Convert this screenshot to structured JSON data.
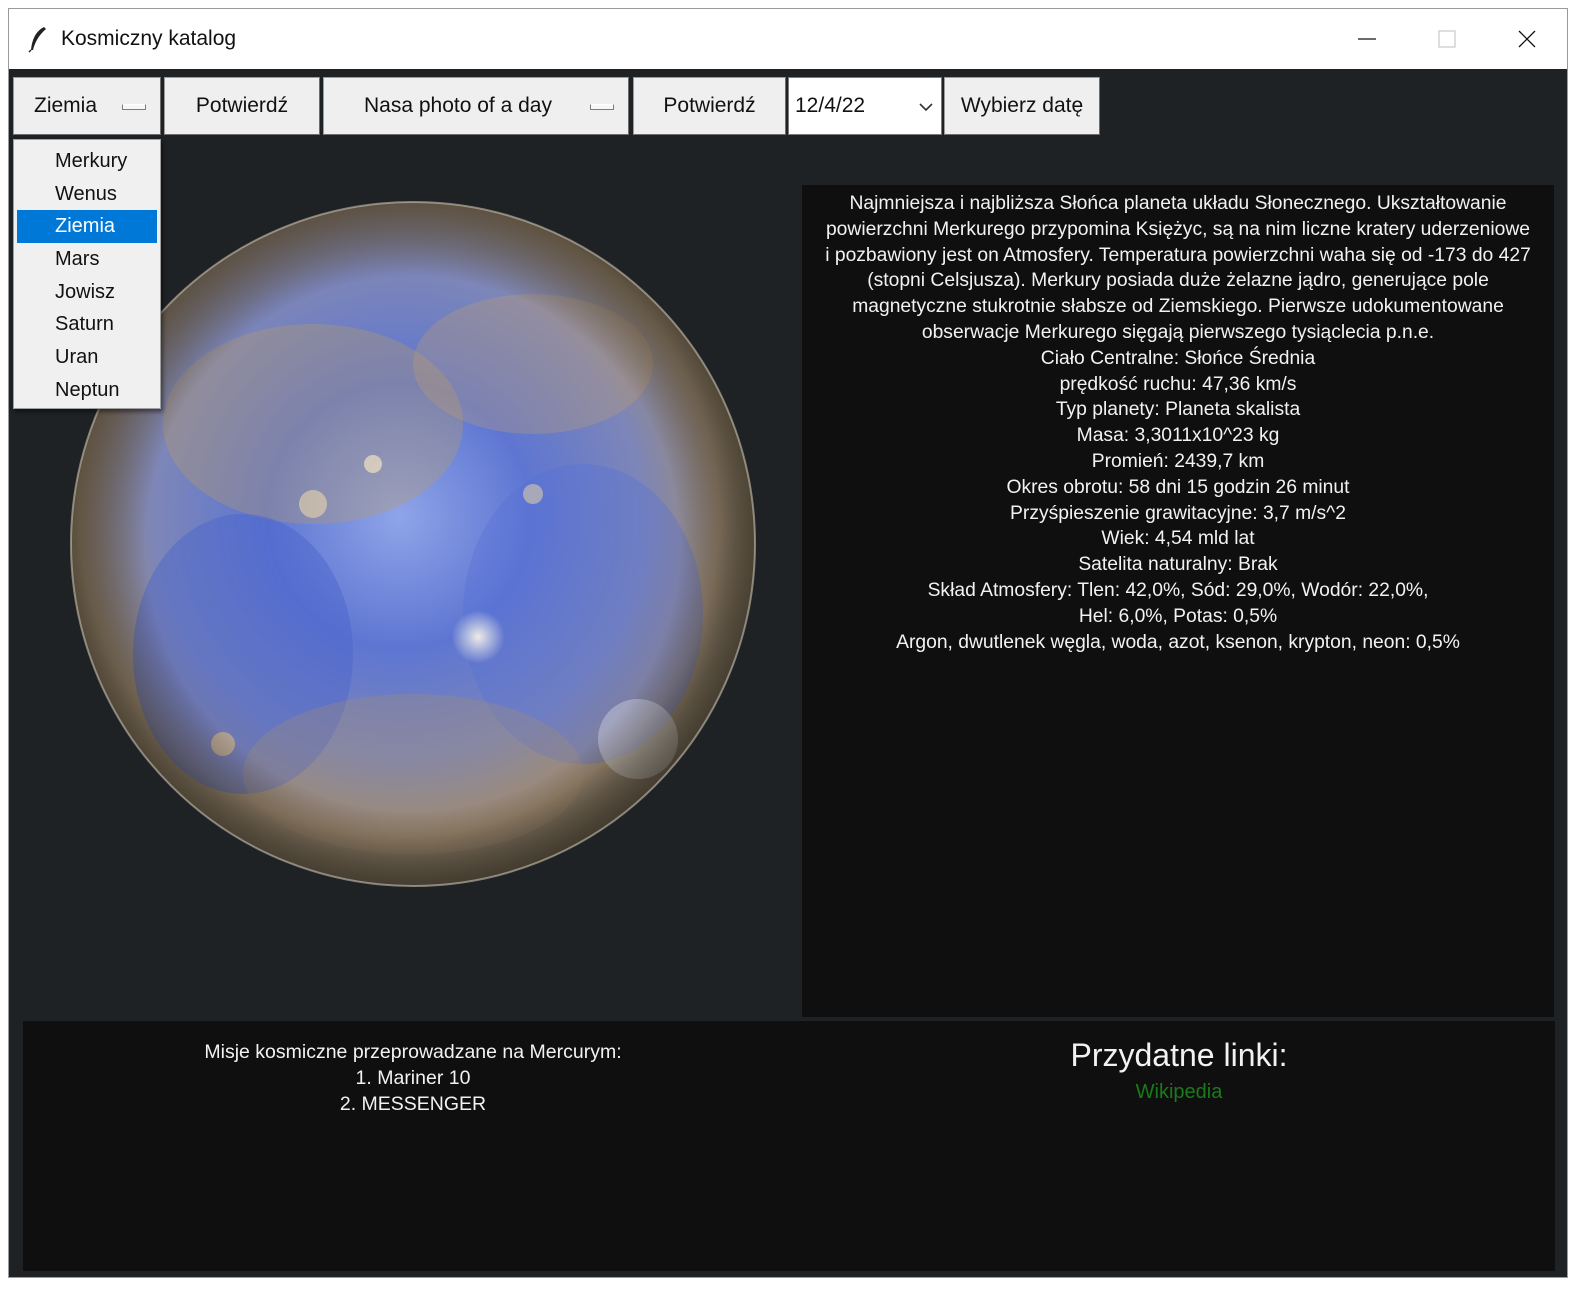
{
  "window": {
    "title": "Kosmiczny katalog"
  },
  "toolbar": {
    "planet_selected": "Ziemia",
    "confirm_label_1": "Potwierdź",
    "mode_selected": "Nasa photo of a day",
    "confirm_label_2": "Potwierdź",
    "date_value": "12/4/22",
    "pick_date_label": "Wybierz datę"
  },
  "dropdown": {
    "items": [
      "Merkury",
      "Wenus",
      "Ziemia",
      "Mars",
      "Jowisz",
      "Saturn",
      "Uran",
      "Neptun"
    ],
    "selected": "Ziemia"
  },
  "info": {
    "lines": [
      "Najmniejsza i najbliższa Słońca planeta układu Słonecznego. Ukształtowanie",
      "powierzchni Merkurego przypomina Księżyc, są na nim liczne kratery uderzeniowe",
      "i pozbawiony jest on Atmosfery. Temperatura powierzchni waha się od -173 do 427",
      "(stopni Celsjusza). Merkury posiada duże żelazne jądro, generujące pole",
      "magnetyczne stukrotnie słabsze od Ziemskiego. Pierwsze udokumentowane",
      "obserwacje Merkurego sięgają pierwszego tysiąclecia p.n.e.",
      "Ciało Centralne: Słońce Średnia",
      "prędkość ruchu: 47,36 km/s",
      "Typ planety: Planeta skalista",
      "Masa: 3,3011x10^23 kg",
      "Promień: 2439,7 km",
      "Okres obrotu: 58 dni 15 godzin 26 minut",
      "Przyśpieszenie grawitacyjne: 3,7 m/s^2",
      "Wiek: 4,54 mld lat",
      "Satelita naturalny: Brak",
      "Skład Atmosfery: Tlen: 42,0%, Sód: 29,0%, Wodór: 22,0%,",
      "Hel: 6,0%, Potas: 0,5%",
      "Argon, dwutlenek węgla, woda, azot, ksenon, krypton, neon: 0,5%"
    ]
  },
  "missions": {
    "title": "Misje kosmiczne przeprowadzane na Mercurym:",
    "items": [
      "1. Mariner 10",
      "2. MESSENGER"
    ]
  },
  "links": {
    "title": "Przydatne linki:",
    "wikipedia": "Wikipedia",
    "link_color": "#1b7a1b"
  },
  "colors": {
    "background": "#1f2224",
    "panel": "#0f0f0f",
    "selection": "#0078d7"
  }
}
